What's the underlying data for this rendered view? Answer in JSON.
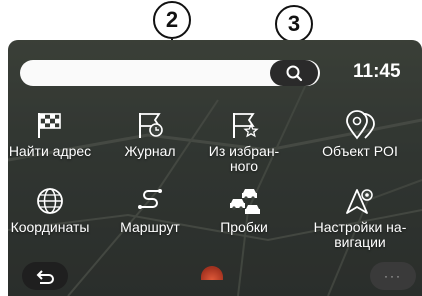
{
  "callouts": {
    "search_field": "2",
    "search_button": "3"
  },
  "header": {
    "time": "11:45",
    "search_placeholder": ""
  },
  "menu": {
    "items": [
      {
        "label": "Найти адрес",
        "icon": "checkered-flag-icon"
      },
      {
        "label": "Журнал",
        "icon": "flag-history-icon"
      },
      {
        "label": "Из избран-\nного",
        "icon": "flag-favorite-icon"
      },
      {
        "label": "Объект POI",
        "icon": "poi-pins-icon"
      },
      {
        "label": "Координаты",
        "icon": "globe-icon"
      },
      {
        "label": "Маршрут",
        "icon": "route-icon"
      },
      {
        "label": "Пробки",
        "icon": "traffic-cars-icon"
      },
      {
        "label": "Настройки на-\nвигации",
        "icon": "navigation-settings-icon"
      }
    ]
  },
  "footer": {
    "back_icon": "back-arrow-icon",
    "more_icon": "more-dots-icon",
    "more_label": "···"
  },
  "colors": {
    "screen_bg": "#3d433e",
    "text": "#ffffff",
    "search_bg": "#fafafa",
    "button_dark": "#2a2a2a"
  }
}
